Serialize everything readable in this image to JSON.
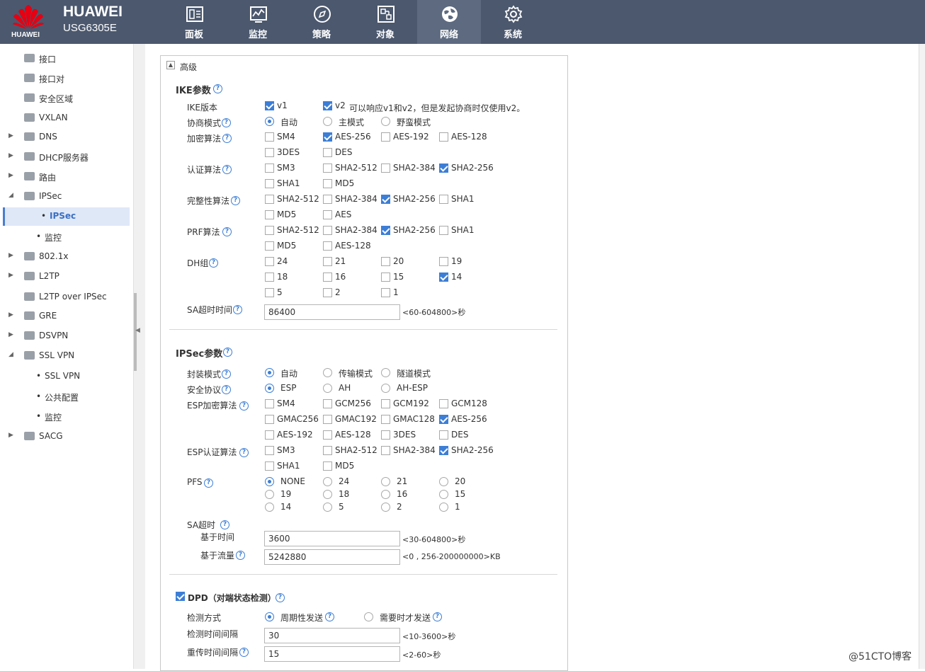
{
  "header": {
    "brand": "HUAWEI",
    "model": "USG6305E",
    "logo_text": "HUAWEI"
  },
  "nav": [
    {
      "label": "面板",
      "icon": "dashboard-icon"
    },
    {
      "label": "监控",
      "icon": "monitor-chart-icon"
    },
    {
      "label": "策略",
      "icon": "compass-icon"
    },
    {
      "label": "对象",
      "icon": "object-icon"
    },
    {
      "label": "网络",
      "icon": "globe-icon",
      "active": true
    },
    {
      "label": "系统",
      "icon": "gear-icon"
    }
  ],
  "sidebar": {
    "items": [
      {
        "label": "接口",
        "level": 1,
        "expand": ""
      },
      {
        "label": "接口对",
        "level": 1,
        "expand": ""
      },
      {
        "label": "安全区域",
        "level": 1,
        "expand": ""
      },
      {
        "label": "VXLAN",
        "level": 1,
        "expand": ""
      },
      {
        "label": "DNS",
        "level": 1,
        "expand": "▶"
      },
      {
        "label": "DHCP服务器",
        "level": 1,
        "expand": "▶"
      },
      {
        "label": "路由",
        "level": 1,
        "expand": "▶"
      },
      {
        "label": "IPSec",
        "level": 1,
        "expand": "◢"
      },
      {
        "label": "IPSec",
        "level": 2,
        "selected": true
      },
      {
        "label": "监控",
        "level": 2
      },
      {
        "label": "802.1x",
        "level": 1,
        "expand": "▶"
      },
      {
        "label": "L2TP",
        "level": 1,
        "expand": "▶"
      },
      {
        "label": "L2TP over IPSec",
        "level": 1,
        "expand": ""
      },
      {
        "label": "GRE",
        "level": 1,
        "expand": "▶"
      },
      {
        "label": "DSVPN",
        "level": 1,
        "expand": "▶"
      },
      {
        "label": "SSL VPN",
        "level": 1,
        "expand": "◢"
      },
      {
        "label": "SSL VPN",
        "level": 2
      },
      {
        "label": "公共配置",
        "level": 2
      },
      {
        "label": "监控",
        "level": 2
      },
      {
        "label": "SACG",
        "level": 1,
        "expand": "▶"
      }
    ]
  },
  "panel": {
    "title": "高级",
    "collapse_symbol": "▲",
    "ike": {
      "title": "IKE参数",
      "version": {
        "label": "IKE版本",
        "v1": "v1",
        "v1_checked": true,
        "v2": "v2",
        "v2_checked": true,
        "note": "可以响应v1和v2，但是发起协商时仅使用v2。"
      },
      "mode": {
        "label": "协商模式",
        "options": [
          "自动",
          "主模式",
          "野蛮模式"
        ],
        "selected": 0
      },
      "encryption": {
        "label": "加密算法",
        "options": [
          [
            "SM4",
            false
          ],
          [
            "AES-256",
            true
          ],
          [
            "AES-192",
            false
          ],
          [
            "AES-128",
            false
          ],
          [
            "3DES",
            false
          ],
          [
            "DES",
            false
          ]
        ]
      },
      "auth": {
        "label": "认证算法",
        "options": [
          [
            "SM3",
            false
          ],
          [
            "SHA2-512",
            false
          ],
          [
            "SHA2-384",
            false
          ],
          [
            "SHA2-256",
            true
          ],
          [
            "SHA1",
            false
          ],
          [
            "MD5",
            false
          ]
        ]
      },
      "integrity": {
        "label": "完整性算法",
        "options": [
          [
            "SHA2-512",
            false
          ],
          [
            "SHA2-384",
            false
          ],
          [
            "SHA2-256",
            true
          ],
          [
            "SHA1",
            false
          ],
          [
            "MD5",
            false
          ],
          [
            "AES",
            false
          ]
        ]
      },
      "prf": {
        "label": "PRF算法",
        "options": [
          [
            "SHA2-512",
            false
          ],
          [
            "SHA2-384",
            false
          ],
          [
            "SHA2-256",
            true
          ],
          [
            "SHA1",
            false
          ],
          [
            "MD5",
            false
          ],
          [
            "AES-128",
            false
          ]
        ]
      },
      "dh": {
        "label": "DH组",
        "options": [
          [
            "24",
            false
          ],
          [
            "21",
            false
          ],
          [
            "20",
            false
          ],
          [
            "19",
            false
          ],
          [
            "18",
            false
          ],
          [
            "16",
            false
          ],
          [
            "15",
            false
          ],
          [
            "14",
            true
          ],
          [
            "5",
            false
          ],
          [
            "2",
            false
          ],
          [
            "1",
            false
          ]
        ]
      },
      "sa_timeout": {
        "label": "SA超时时间",
        "value": "86400",
        "hint": "<60-604800>秒"
      }
    },
    "ipsec": {
      "title": "IPSec参数",
      "encap": {
        "label": "封装模式",
        "options": [
          "自动",
          "传输模式",
          "隧道模式"
        ],
        "selected": 0
      },
      "protocol": {
        "label": "安全协议",
        "options": [
          "ESP",
          "AH",
          "AH-ESP"
        ],
        "selected": 0
      },
      "esp_enc": {
        "label": "ESP加密算法",
        "options": [
          [
            "SM4",
            false
          ],
          [
            "GCM256",
            false
          ],
          [
            "GCM192",
            false
          ],
          [
            "GCM128",
            false
          ],
          [
            "GMAC256",
            false
          ],
          [
            "GMAC192",
            false
          ],
          [
            "GMAC128",
            false
          ],
          [
            "AES-256",
            true
          ],
          [
            "AES-192",
            false
          ],
          [
            "AES-128",
            false
          ],
          [
            "3DES",
            false
          ],
          [
            "DES",
            false
          ]
        ]
      },
      "esp_auth": {
        "label": "ESP认证算法",
        "options": [
          [
            "SM3",
            false
          ],
          [
            "SHA2-512",
            false
          ],
          [
            "SHA2-384",
            false
          ],
          [
            "SHA2-256",
            true
          ],
          [
            "SHA1",
            false
          ],
          [
            "MD5",
            false
          ]
        ]
      },
      "pfs": {
        "label": "PFS",
        "options": [
          "NONE",
          "24",
          "21",
          "20",
          "19",
          "18",
          "16",
          "15",
          "14",
          "5",
          "2",
          "1"
        ],
        "selected": 0
      },
      "sa": {
        "label": "SA超时",
        "time_label": "基于时间",
        "time_value": "3600",
        "time_hint": "<30-604800>秒",
        "flow_label": "基于流量",
        "flow_value": "5242880",
        "flow_hint": "<0 , 256-200000000>KB"
      }
    },
    "dpd": {
      "title": "DPD（对端状态检测）",
      "checked": true,
      "method": {
        "label": "检测方式",
        "options": [
          "周期性发送",
          "需要时才发送"
        ],
        "selected": 0
      },
      "interval": {
        "label": "检测时间间隔",
        "value": "30",
        "hint": "<10-3600>秒"
      },
      "retry": {
        "label": "重传时间间隔",
        "value": "15",
        "hint": "<2-60>秒"
      }
    }
  },
  "watermark": "@51CTO博客"
}
